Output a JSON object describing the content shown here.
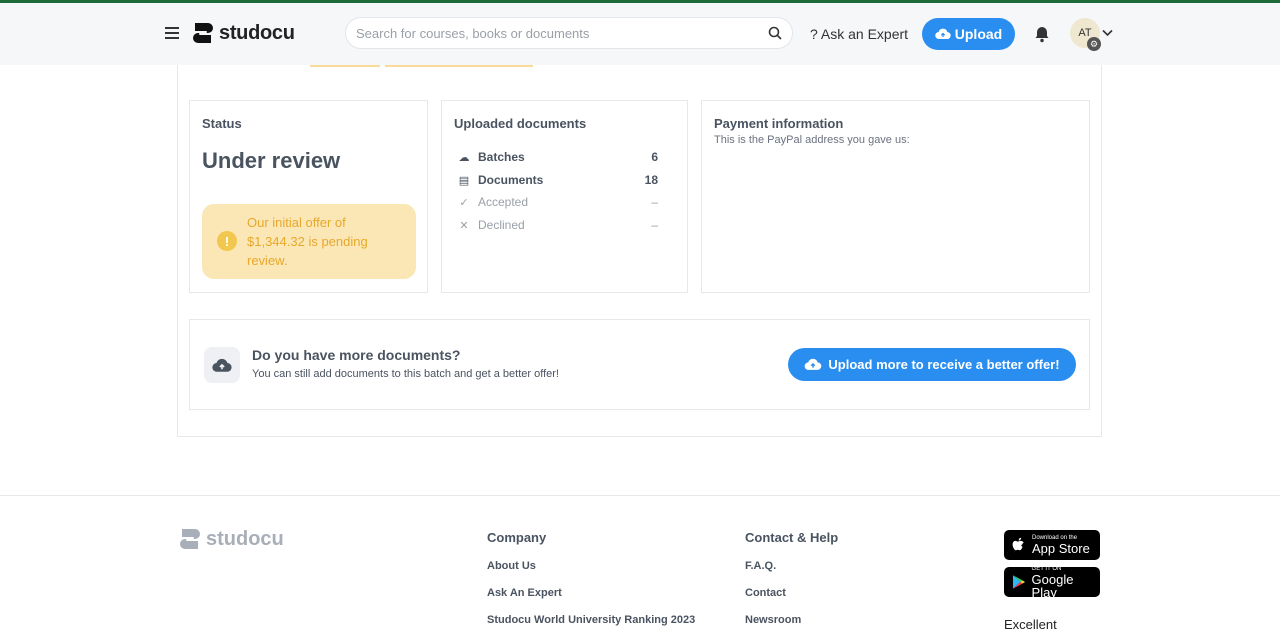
{
  "header": {
    "logo_text": "studocu",
    "search_placeholder": "Search for courses, books or documents",
    "ask_label": "? Ask an Expert",
    "upload_label": "Upload",
    "avatar_initials": "AT"
  },
  "status_card": {
    "title": "Status",
    "value": "Under review",
    "notice": "Our initial offer of $1,344.32 is pending review."
  },
  "uploaded_card": {
    "title": "Uploaded documents",
    "rows": [
      {
        "label": "Batches",
        "value": "6"
      },
      {
        "label": "Documents",
        "value": "18"
      },
      {
        "label": "Accepted",
        "value": "–"
      },
      {
        "label": "Declined",
        "value": "–"
      }
    ]
  },
  "payment_card": {
    "title": "Payment information",
    "subtitle": "This is the PayPal address you gave us:"
  },
  "more_docs": {
    "title": "Do you have more documents?",
    "subtitle": "You can still add documents to this batch and get a better offer!",
    "button": "Upload more to receive a better offer!"
  },
  "footer": {
    "logo_text": "studocu",
    "company": {
      "title": "Company",
      "links": [
        "About Us",
        "Ask An Expert",
        "Studocu World University Ranking 2023"
      ]
    },
    "contact": {
      "title": "Contact & Help",
      "links": [
        "F.A.Q.",
        "Contact",
        "Newsroom"
      ]
    },
    "app_store": {
      "small": "Download on the",
      "big": "App Store"
    },
    "google_play": {
      "small": "GET IT ON",
      "big": "Google Play"
    },
    "rating": "Excellent"
  }
}
